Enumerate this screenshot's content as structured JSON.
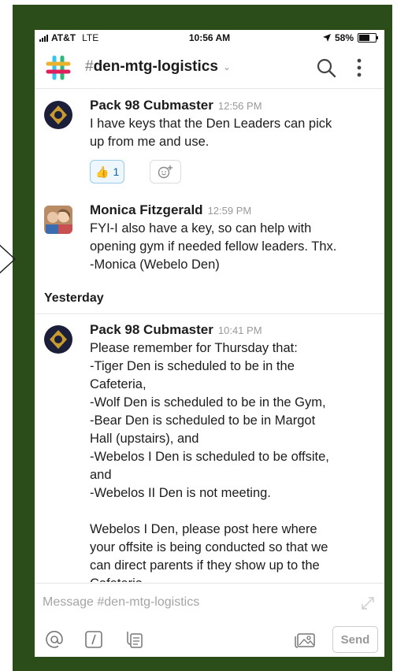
{
  "status_bar": {
    "carrier": "AT&T",
    "network": "LTE",
    "time": "10:56 AM",
    "battery": "58%"
  },
  "header": {
    "hash": "#",
    "channel_name": "den-mtg-logistics",
    "chevron": "⌄"
  },
  "messages": [
    {
      "sender": "Pack 98 Cubmaster",
      "time": "12:56 PM",
      "text": "I have keys that the Den Leaders can pick\nup from me and use.",
      "reaction": {
        "emoji": "👍",
        "count": "1"
      }
    },
    {
      "sender": "Monica Fitzgerald",
      "time": "12:59 PM",
      "text": "FYI-I also have a key, so can help with\nopening gym if needed fellow leaders. Thx.\n-Monica (Webelo Den)"
    },
    {
      "sender": "Pack 98 Cubmaster",
      "time": "10:41 PM",
      "text": "Please remember for Thursday that:\n-Tiger Den is scheduled to be in the\nCafeteria,\n-Wolf Den is scheduled to be in the Gym,\n-Bear Den is scheduled to be in Margot\nHall (upstairs), and\n-Webelos I Den is scheduled to be offsite,\nand\n-Webelos II Den is not meeting.\n\nWebelos I Den, please post here where\nyour offsite is being conducted so that we\ncan direct parents if they show up to the\nCafeteria."
    }
  ],
  "day_divider": "Yesterday",
  "composer": {
    "placeholder": "Message #den-mtg-logistics",
    "send_label": "Send"
  },
  "icons": {
    "logo": "slack-logo",
    "search": "search-icon",
    "more": "more-vertical-icon",
    "mention": "at-icon",
    "command": "slash-icon",
    "attach": "file-icon",
    "photo": "photo-icon",
    "expand": "expand-icon",
    "add_reaction": "add-reaction-icon"
  },
  "colors": {
    "frame": "#2b4d19",
    "reaction_bg": "#eef7fd",
    "reaction_border": "#9ccbe8",
    "timestamp": "#999999"
  }
}
